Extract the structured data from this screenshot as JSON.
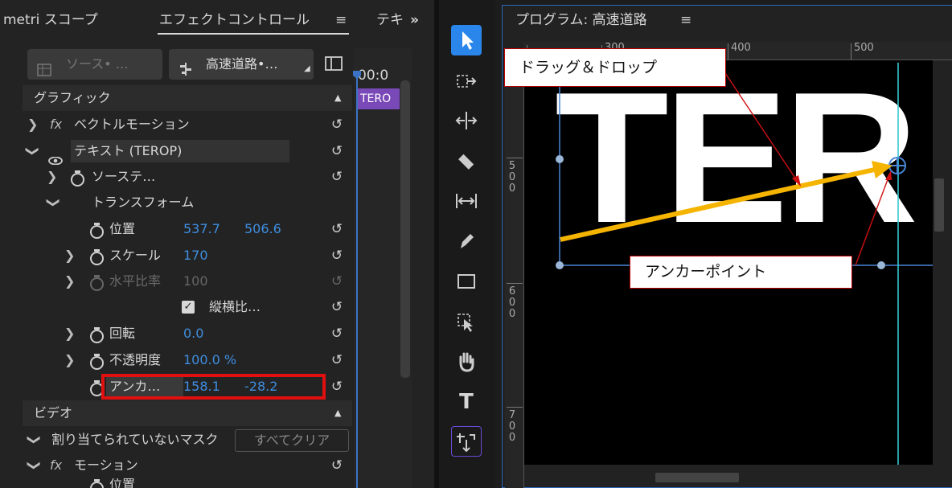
{
  "left_panel": {
    "tabs": [
      {
        "label": "metri スコープ"
      },
      {
        "label": "エフェクトコントロール"
      },
      {
        "label": "テキ"
      }
    ],
    "overflow_symbol": "»",
    "menu_symbol": "≡",
    "source_pill": "ソース• …",
    "sequence_pill": "高速道路•…",
    "timecode": "00:0",
    "clip_label": "TERO",
    "sections": {
      "graphics": "グラフィック",
      "video": "ビデオ"
    },
    "rows": {
      "vector_motion": "ベクトルモーション",
      "text_layer": "テキスト (TEROP)",
      "source_text": "ソーステ…",
      "transform": "トランスフォーム",
      "position": {
        "label": "位置",
        "x": "537.7",
        "y": "506.6"
      },
      "scale": {
        "label": "スケール",
        "value": "170"
      },
      "scale_width": {
        "label": "水平比率",
        "value": "100"
      },
      "uniform_scale": {
        "label": "縦横比…"
      },
      "rotation": {
        "label": "回転",
        "value": "0.0"
      },
      "opacity": {
        "label": "不透明度",
        "value": "100.0 %"
      },
      "anchor": {
        "label": "アンカ…",
        "x": "158.1",
        "y": "-28.2"
      },
      "unassigned_mask": "割り当てられていないマスク",
      "clear_all": "すべてクリア",
      "motion": "モーション",
      "motion_position_partial": "位置"
    },
    "fx_symbol": "fx"
  },
  "toolbar": {
    "tools": [
      "selection-tool",
      "track-select-tool",
      "ripple-edit-tool",
      "razor-tool",
      "slip-tool",
      "pen-tool",
      "rectangle-tool",
      "transform-tool",
      "hand-tool",
      "type-tool",
      "graphics-tool"
    ],
    "type_glyph": "T"
  },
  "program_monitor": {
    "title": "プログラム: 高速道路",
    "menu_symbol": "≡",
    "ruler_top_labels": [
      "300",
      "400",
      "500"
    ],
    "ruler_left_labels": [
      "500",
      "600",
      "700"
    ],
    "canvas_text": "TER"
  },
  "annotations": {
    "drag_drop": "ドラッグ＆ドロップ",
    "anchor_point": "アンカーポイント",
    "highlight_color": "#e01010",
    "arrow_color": "#f5b400",
    "accent_color": "#2a86ea"
  }
}
